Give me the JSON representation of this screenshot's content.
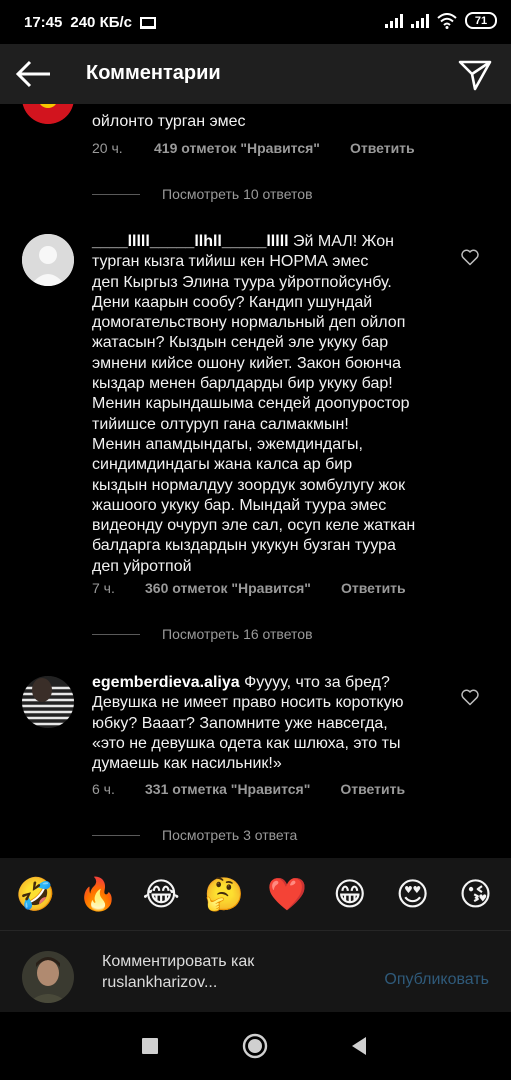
{
  "status_bar": {
    "time": "17:45",
    "data_speed": "240 КБ/с",
    "battery": "71"
  },
  "header": {
    "title": "Комментарии"
  },
  "comments": [
    {
      "text_tail": "ойлонто турган эмес",
      "time": "20 ч.",
      "likes": "419 отметок \"Нравится\"",
      "reply": "Ответить",
      "view_replies": "Посмотреть 10 ответов"
    },
    {
      "username": "____lllll_____llhll_____lllll",
      "text": [
        "Эй МАЛ! Жон",
        "турган кызга тийиш кен НОРМА эмес",
        "деп Кыргыз Элина туура уйротпойсунбу.",
        "Дени каарын сообу? Кандип ушундай",
        "домогательствону нормальный деп ойлоп",
        "жатасын? Кыздын сендей эле укуку бар",
        "эмнени кийсе ошону кийет. Закон боюнча",
        "кыздар менен барлдарды бир укуку бар!",
        "Менин карындашыма сендей доопуростор",
        "тийишсе олтуруп гана салмакмын!",
        "Менин апамдындагы, эжемдиндагы,",
        "синдимдиндагы жана калса ар бир",
        "кыздын нормалдуу зоордук зомбулугу жок",
        "жашоого укуку бар. Мындай туура эмес",
        "видеонду очуруп эле сал, осуп келе жаткан",
        "балдарга кыздардын укукун бузган туура",
        "деп уйротпой"
      ],
      "time": "7 ч.",
      "likes": "360 отметок \"Нравится\"",
      "reply": "Ответить",
      "view_replies": "Посмотреть 16 ответов"
    },
    {
      "username": "egemberdieva.aliya",
      "text": [
        "Фуууу, что за бред?",
        "Девушка не имеет право носить короткую",
        "юбку? Вааат? Запомните уже навсегда,",
        "«это не девушка одета как шлюха, это ты",
        "думаешь как насильник!»"
      ],
      "time": "6 ч.",
      "likes": "331 отметка \"Нравится\"",
      "reply": "Ответить",
      "view_replies": "Посмотреть 3 ответа"
    }
  ],
  "reactions": [
    "🤣",
    "🔥",
    "😂",
    "🤔",
    "❤️",
    "😁",
    "😍",
    "😘"
  ],
  "compose": {
    "placeholder_line1": "Комментировать как",
    "placeholder_line2": "ruslankharizov...",
    "publish": "Опубликовать"
  }
}
